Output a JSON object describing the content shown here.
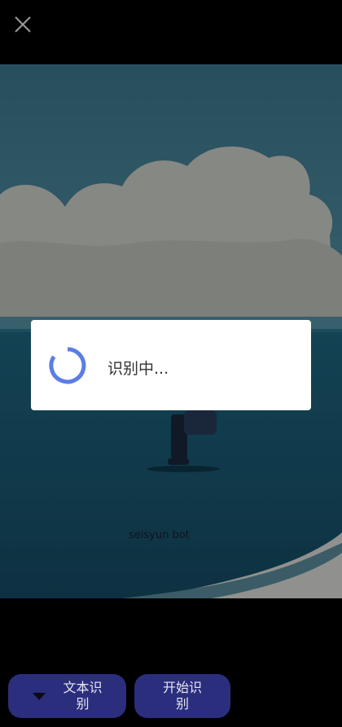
{
  "toolbar": {
    "close_icon": "close-icon"
  },
  "dialog": {
    "loading_text": "识别中..."
  },
  "photo": {
    "watermark": "seisyun bot"
  },
  "bottom_bar": {
    "text_recognition_label": "文本识别",
    "start_recognition_label": "开始识别",
    "dropdown_icon": "triangle-down-icon"
  },
  "colors": {
    "button_bg": "#2b2e7d",
    "spinner": "#5b7de6",
    "dialog_bg": "#ffffff"
  }
}
